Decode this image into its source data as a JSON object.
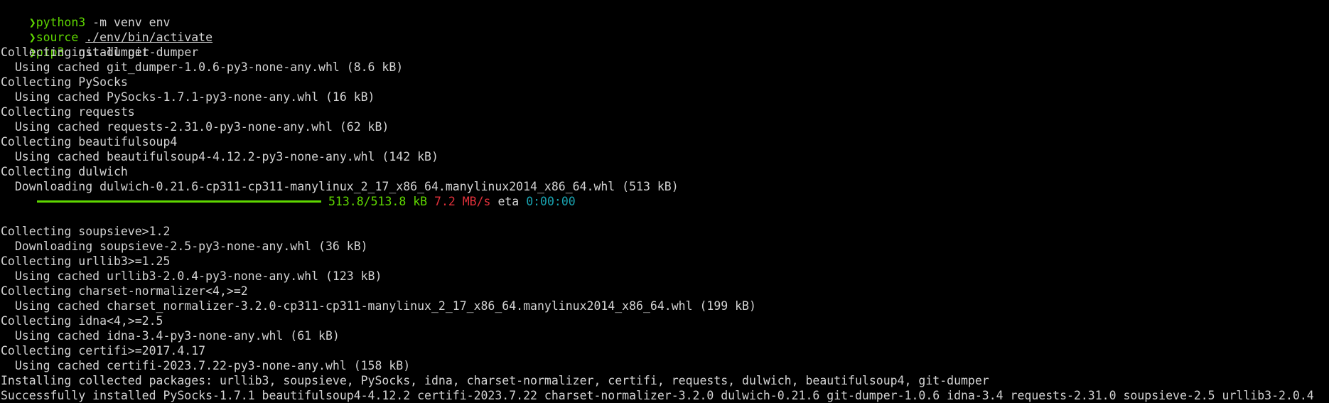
{
  "colors": {
    "background": "#000000",
    "text": "#d3d3d3",
    "prompt_green": "#5fd700",
    "speed_red": "#e0303a",
    "eta_cyan": "#19a3b0"
  },
  "prompt_symbol": "❯",
  "commands": [
    {
      "cmd": "python3",
      "args": " -m venv env"
    },
    {
      "cmd": "source",
      "args_pre": " ",
      "path": "./env/bin/activate"
    },
    {
      "cmd": "pip3",
      "args": " install git-dumper"
    }
  ],
  "output_before_progress": [
    "Collecting git-dumper",
    "  Using cached git_dumper-1.0.6-py3-none-any.whl (8.6 kB)",
    "Collecting PySocks",
    "  Using cached PySocks-1.7.1-py3-none-any.whl (16 kB)",
    "Collecting requests",
    "  Using cached requests-2.31.0-py3-none-any.whl (62 kB)",
    "Collecting beautifulsoup4",
    "  Using cached beautifulsoup4-4.12.2-py3-none-any.whl (142 kB)",
    "Collecting dulwich",
    "  Downloading dulwich-0.21.6-cp311-cp311-manylinux_2_17_x86_64.manylinux2014_x86_64.whl (513 kB)"
  ],
  "progress": {
    "fraction": 1.0,
    "size": "513.8/513.8 kB",
    "speed": "7.2 MB/s",
    "eta_label": "eta",
    "eta": "0:00:00"
  },
  "output_after_progress": [
    "Collecting soupsieve>1.2",
    "  Downloading soupsieve-2.5-py3-none-any.whl (36 kB)",
    "Collecting urllib3>=1.25",
    "  Using cached urllib3-2.0.4-py3-none-any.whl (123 kB)",
    "Collecting charset-normalizer<4,>=2",
    "  Using cached charset_normalizer-3.2.0-cp311-cp311-manylinux_2_17_x86_64.manylinux2014_x86_64.whl (199 kB)",
    "Collecting idna<4,>=2.5",
    "  Using cached idna-3.4-py3-none-any.whl (61 kB)",
    "Collecting certifi>=2017.4.17",
    "  Using cached certifi-2023.7.22-py3-none-any.whl (158 kB)",
    "Installing collected packages: urllib3, soupsieve, PySocks, idna, charset-normalizer, certifi, requests, dulwich, beautifulsoup4, git-dumper",
    "Successfully installed PySocks-1.7.1 beautifulsoup4-4.12.2 certifi-2023.7.22 charset-normalizer-3.2.0 dulwich-0.21.6 git-dumper-1.0.6 idna-3.4 requests-2.31.0 soupsieve-2.5 urllib3-2.0.4"
  ]
}
